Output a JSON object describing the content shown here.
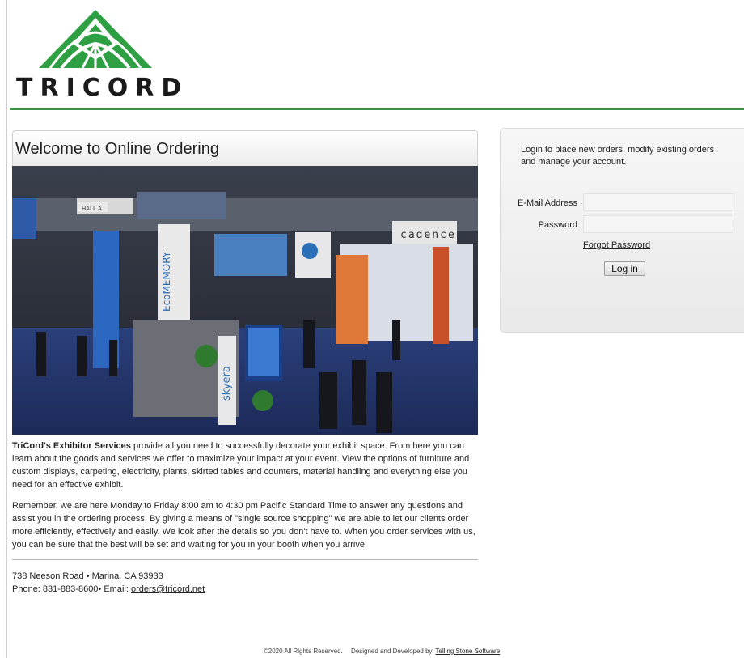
{
  "brand": {
    "name": "TRICORD",
    "accent": "#3f8f4a",
    "logo_green": "#2ea043"
  },
  "main": {
    "title": "Welcome to Online Ordering",
    "hero": {
      "signs": [
        "cadence",
        "EcoMEMORY",
        "skyera",
        "HALL A"
      ]
    },
    "intro_bold": "TriCord's Exhibitor Services",
    "intro_rest": " provide all you need to successfully decorate your exhibit space.  From here you can learn about the goods and services we offer to maximize your impact at your event.  View the options of furniture and custom displays, carpeting, electricity, plants, skirted tables and counters, material handling and everything else you need for an effective exhibit.",
    "para2": "Remember, we are here Monday to Friday 8:00 am to 4:30 pm Pacific Standard Time to answer any questions and assist you in the ordering process.  By giving a means of \"single source shopping\" we are able to let our clients order more efficiently, effectively and easily.  We look after the details so you don't have to.  When you order services with us, you can be sure that the best will be set and waiting for you in your booth when you arrive.",
    "address_line": "738 Neeson Road • Marina, CA 93933",
    "phone_text": "Phone: 831-883-8600• Email: ",
    "email": "orders@tricord.net"
  },
  "login": {
    "intro": "Login to place new orders, modify existing orders and manage your account.",
    "email_label": "E-Mail Address",
    "email_value": "",
    "password_label": "Password",
    "password_value": "",
    "forgot_label": "Forgot Password",
    "submit_label": "Log in"
  },
  "footer": {
    "copyright": "©2020 All Rights Reserved.",
    "designed_by": "Designed and Developed by",
    "developer": "Telling Stone Software"
  }
}
